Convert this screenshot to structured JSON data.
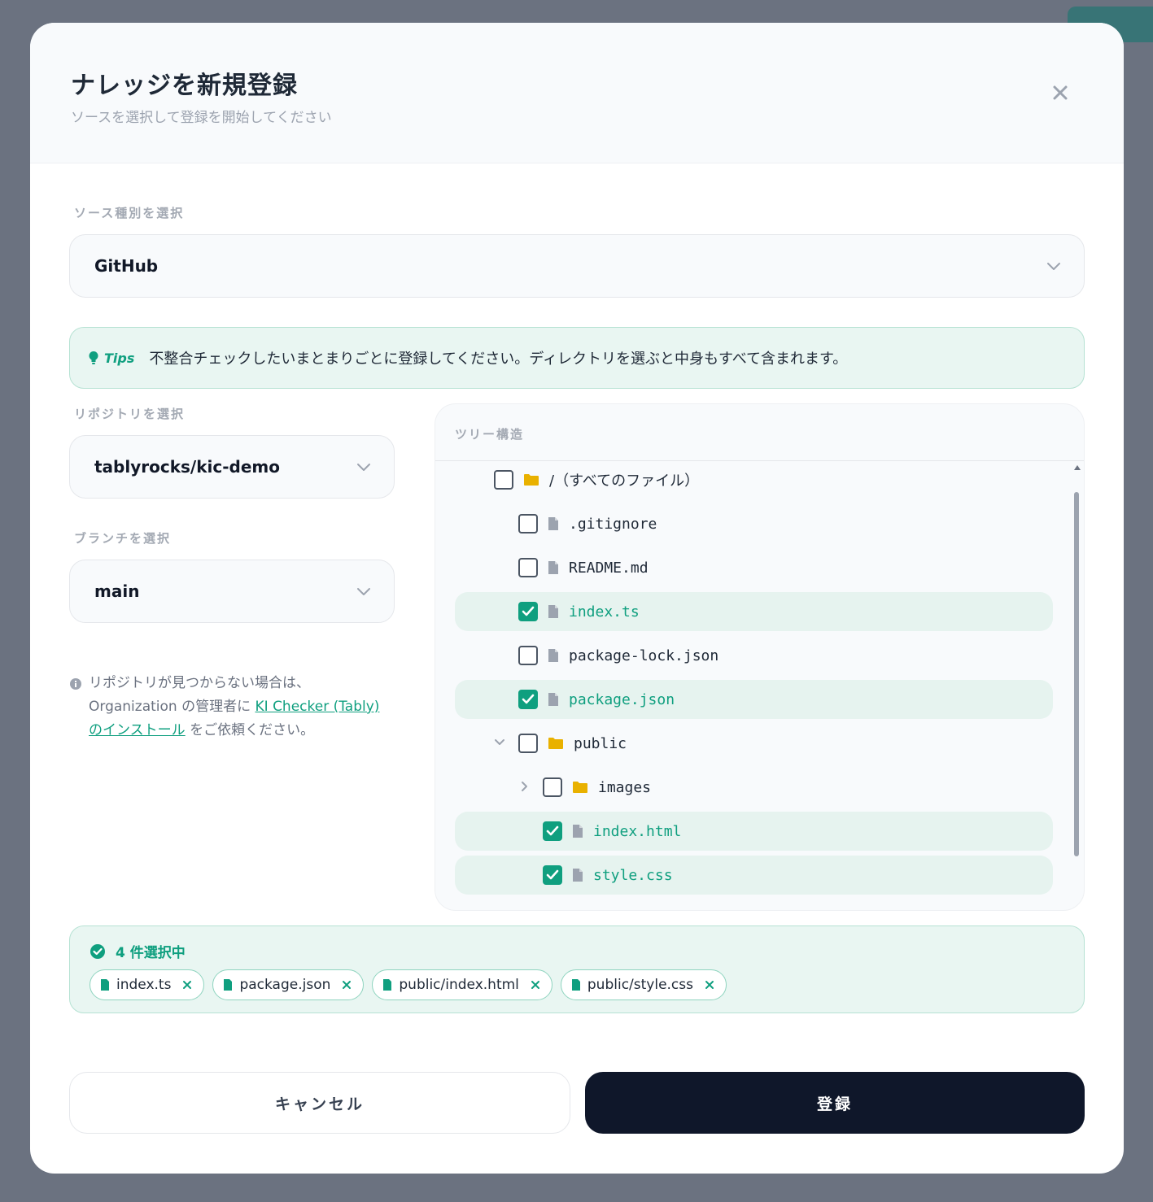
{
  "header": {
    "title": "ナレッジを新規登録",
    "subtitle": "ソースを選択して登録を開始してください"
  },
  "source": {
    "label": "ソース種別を選択",
    "value": "GitHub"
  },
  "tips": {
    "label": "Tips",
    "text": "不整合チェックしたいまとまりごとに登録してください。ディレクトリを選ぶと中身もすべて含まれます。"
  },
  "repository": {
    "label": "リポジトリを選択",
    "value": "tablyrocks/kic-demo"
  },
  "branch": {
    "label": "ブランチを選択",
    "value": "main"
  },
  "hint": {
    "prefix": "リポジトリが見つからない場合は、Organization の管理者に",
    "link": "KI Checker (Tably) のインストール",
    "suffix": "をご依頼ください。"
  },
  "tree": {
    "label": "ツリー構造",
    "items": [
      {
        "name": "/（すべてのファイル）",
        "type": "folder",
        "checked": false
      },
      {
        "name": ".gitignore",
        "type": "file",
        "checked": false
      },
      {
        "name": "README.md",
        "type": "file",
        "checked": false
      },
      {
        "name": "index.ts",
        "type": "file",
        "checked": true
      },
      {
        "name": "package-lock.json",
        "type": "file",
        "checked": false
      },
      {
        "name": "package.json",
        "type": "file",
        "checked": true
      },
      {
        "name": "public",
        "type": "folder",
        "checked": false,
        "expanded": true
      },
      {
        "name": "images",
        "type": "folder",
        "checked": false,
        "expanded": false
      },
      {
        "name": "index.html",
        "type": "file",
        "checked": true
      },
      {
        "name": "style.css",
        "type": "file",
        "checked": true
      }
    ]
  },
  "selection": {
    "count_label": "4 件選択中",
    "chips": [
      "index.ts",
      "package.json",
      "public/index.html",
      "public/style.css"
    ]
  },
  "footer": {
    "cancel_label": "キャンセル",
    "submit_label": "登録"
  },
  "colors": {
    "accent": "#0f9f7f",
    "folder": "#e9b100",
    "submit_bg": "#0f172a"
  }
}
